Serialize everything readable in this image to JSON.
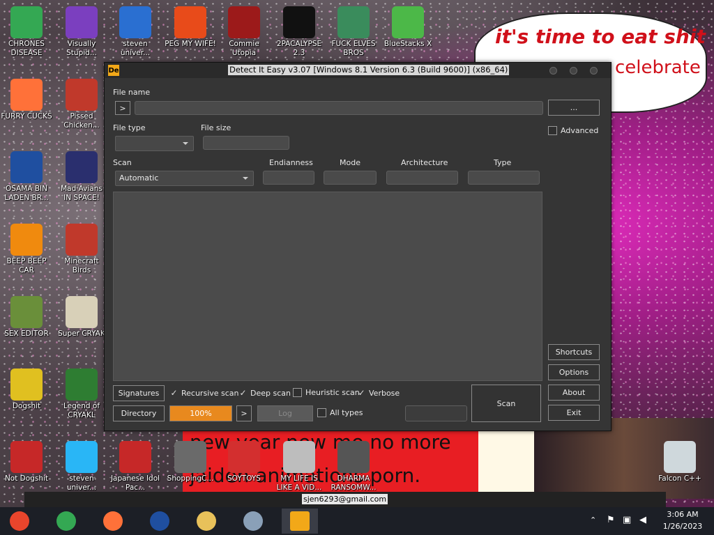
{
  "desktop": {
    "icons": [
      {
        "label": "CHRONES DISEASE",
        "icon": "chrome-icon",
        "color": "#34a853"
      },
      {
        "label": "Visually Stupid...",
        "icon": "visual-studio-icon",
        "color": "#7b3fbf"
      },
      {
        "label": "steven univer...",
        "icon": "steven-universe-icon",
        "color": "#2a6fd1"
      },
      {
        "label": "PEG MY WIFE!",
        "icon": "peggle-icon",
        "color": "#e84b1a"
      },
      {
        "label": "Commie Utopia",
        "icon": "commie-icon",
        "color": "#9c1a1a"
      },
      {
        "label": "2PACALYPSE 2.3",
        "icon": "cmd-icon",
        "color": "#111111"
      },
      {
        "label": "FUCK ELVES BROS",
        "icon": "elf-icon",
        "color": "#3a8c5c"
      },
      {
        "label": "BlueStacks X",
        "icon": "bluestacks-icon",
        "color": "#4cb848"
      },
      {
        "label": "FURRY CUCKS",
        "icon": "firefox-icon",
        "color": "#ff7139"
      },
      {
        "label": "Pissed Chicken...",
        "icon": "angry-birds-seasons-icon",
        "color": "#c0392b"
      },
      {
        "label": "OSAMA BIN LADEN BR...",
        "icon": "obama-logo-icon",
        "color": "#1f4fa0"
      },
      {
        "label": "Mad Avians IN SPACE!",
        "icon": "angry-birds-space-icon",
        "color": "#2a2f6e"
      },
      {
        "label": "BEEP BEEP CAR",
        "icon": "vlc-icon",
        "color": "#f08a0e"
      },
      {
        "label": "Minecraft Birds",
        "icon": "angry-birds-icon",
        "color": "#c0392b"
      },
      {
        "label": "SEX EDITOR",
        "icon": "hxd-icon",
        "color": "#6a8f3a"
      },
      {
        "label": "Super CRYAK",
        "icon": "pixel-cat-icon",
        "color": "#d8d0b8"
      },
      {
        "label": "Dogshit",
        "icon": "dogshit-icon",
        "color": "#e0c020"
      },
      {
        "label": "Legend of CRYAKL",
        "icon": "legend-icon",
        "color": "#2e7d32"
      },
      {
        "label": "Not Dogshit",
        "icon": "dev-cpp-icon",
        "color": "#c62828"
      },
      {
        "label": "steven univer...",
        "icon": "diamond-icon",
        "color": "#29b6f6"
      },
      {
        "label": "Japanese Idol Pac...",
        "icon": "torii-icon",
        "color": "#c62828"
      },
      {
        "label": "ShoppingC...",
        "icon": "flash-icon",
        "color": "#6a6a6a"
      },
      {
        "label": "SOYTOYS",
        "icon": "soytoys-icon",
        "color": "#d32f2f"
      },
      {
        "label": "MY LIFE IS LIKE A VID...",
        "icon": "gamepad-icon",
        "color": "#bdbdbd"
      },
      {
        "label": "DHARMA RANSOMW...",
        "icon": "skull-icon",
        "color": "#555555"
      },
      {
        "label": "Falcon C++",
        "icon": "recycle-bin-icon",
        "color": "#cfd8dc"
      }
    ],
    "bubble_line1": "it's time to eat shit",
    "bubble_line2": "celebrate",
    "banner_line1": "new year new me no more",
    "banner_line2": "jaiden animations porn.",
    "email_tag": "sjen6293@gmail.com"
  },
  "window": {
    "title": "Detect It Easy v3.07 [Windows 8.1 Version 6.3 (Build 9600)] (x86_64)",
    "app_icon_text": "De",
    "file_name_label": "File name",
    "file_name_value": "",
    "arrow_label": ">",
    "browse_label": "...",
    "file_type_label": "File type",
    "file_type_value": "",
    "file_size_label": "File size",
    "file_size_value": "",
    "scan_label": "Scan",
    "scan_value": "Automatic",
    "endianness_label": "Endianness",
    "mode_label": "Mode",
    "architecture_label": "Architecture",
    "type_label": "Type",
    "advanced_label": "Advanced",
    "signatures_label": "Signatures",
    "recursive_label": "Recursive scan",
    "deep_label": "Deep scan",
    "heuristic_label": "Heuristic scan",
    "verbose_label": "Verbose",
    "directory_label": "Directory",
    "progress_text": "100%",
    "progress_value": 100,
    "next_label": ">",
    "log_label": "Log",
    "all_types_label": "All types",
    "scan_button_label": "Scan",
    "shortcuts_label": "Shortcuts",
    "options_label": "Options",
    "about_label": "About",
    "exit_label": "Exit",
    "checks": {
      "advanced": false,
      "recursive": true,
      "deep": true,
      "heuristic": false,
      "verbose": true,
      "all_types": false
    },
    "accent_progress": "#e8891e"
  },
  "taskbar": {
    "time": "3:06 AM",
    "date": "1/26/2023",
    "apps": [
      {
        "name": "chrome-old-icon",
        "color": "#e8452c"
      },
      {
        "name": "chrome-icon",
        "color": "#34a853"
      },
      {
        "name": "firefox-icon",
        "color": "#ff7139"
      },
      {
        "name": "obama-logo-icon",
        "color": "#1f4fa0"
      },
      {
        "name": "file-explorer-icon",
        "color": "#e8c15a"
      },
      {
        "name": "control-panel-icon",
        "color": "#8aa0b8"
      },
      {
        "name": "detect-it-easy-icon",
        "color": "#f2a818"
      }
    ]
  }
}
